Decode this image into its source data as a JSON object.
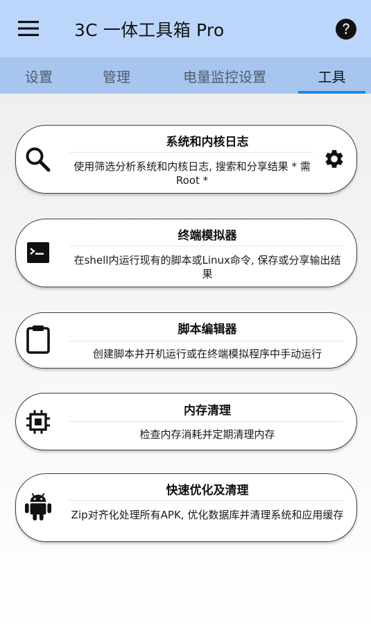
{
  "appbar": {
    "title": "3C 一体工具箱 Pro",
    "menu_icon": "menu-icon",
    "help_icon": "help-circle-icon",
    "background": "#bcd6fb"
  },
  "tabs": {
    "items": [
      {
        "label": "设置",
        "active": false
      },
      {
        "label": "管理",
        "active": false
      },
      {
        "label": "电量监控设置",
        "active": false
      },
      {
        "label": "工具",
        "active": true
      }
    ],
    "background": "#a7c5ee",
    "indicator_color": "#1e88e5"
  },
  "tools": [
    {
      "title": "系统和内核日志",
      "description": "使用筛选分析系统和内核日志, 搜索和分享结果 * 需Root *",
      "icon": "search-icon",
      "has_settings": true
    },
    {
      "title": "终端模拟器",
      "description": "在shell内运行现有的脚本或Linux命令, 保存或分享输出结果",
      "icon": "terminal-icon",
      "has_settings": false
    },
    {
      "title": "脚本编辑器",
      "description": "创建脚本并开机运行或在终端模拟程序中手动运行",
      "icon": "clipboard-icon",
      "has_settings": false
    },
    {
      "title": "内存清理",
      "description": "检查内存消耗并定期清理内存",
      "icon": "memory-chip-icon",
      "has_settings": false
    },
    {
      "title": "快速优化及清理",
      "description": "Zip对齐化处理所有APK, 优化数据库并清理系统和应用缓存",
      "icon": "android-icon",
      "has_settings": false
    }
  ]
}
